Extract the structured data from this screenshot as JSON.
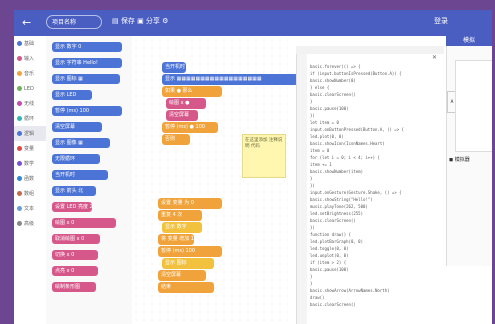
{
  "topbar": {
    "back_label": "←",
    "search_placeholder": "项目名称",
    "tools": "▤ 保存  ▣ 分享  ⚙",
    "user": "登录"
  },
  "right_tab": "模拟",
  "categories": [
    {
      "label": "基础",
      "color": "#4c73d6"
    },
    {
      "label": "输入",
      "color": "#d6578a"
    },
    {
      "label": "音乐",
      "color": "#f0a33a"
    },
    {
      "label": "LED",
      "color": "#6fb15c"
    },
    {
      "label": "无线",
      "color": "#c44ab4"
    },
    {
      "label": "循环",
      "color": "#2fb7b0"
    },
    {
      "label": "逻辑",
      "color": "#4c73d6"
    },
    {
      "label": "变量",
      "color": "#e04848"
    },
    {
      "label": "数学",
      "color": "#7b4fd6"
    },
    {
      "label": "函数",
      "color": "#2f87d6"
    },
    {
      "label": "数组",
      "color": "#c46a4a"
    },
    {
      "label": "文本",
      "color": "#6a9cd6"
    },
    {
      "label": "高级",
      "color": "#888888"
    }
  ],
  "palette_blocks": [
    "显示 数字 0",
    "显示 字符串 Hello!",
    "显示 图标 ▦",
    "显示 LED",
    "暂停 (ms) 100",
    "清空屏幕",
    "显示 图像 ▦",
    "无限循环",
    "当开机时",
    "显示 箭头 北",
    "设置 LED 亮度 255",
    "绘图 x 0",
    "取消绘图 x 0",
    "切换 x 0",
    "点亮 x 0",
    "绘制条形图"
  ],
  "workspace_blocks": {
    "head": "当开机时",
    "b1": "显示 ▦▦▦▦▦▦▦▦▦▦▦▦▦▦▦▦▦▦",
    "b2": "如果 ● 那么",
    "b3": "绘图 x ●",
    "b4": "清空屏幕",
    "b5": "暂停 (ms) ● 100",
    "b6": "否则",
    "g1": "设置 变量 为 0",
    "g2": "重复 4 次",
    "g3": "显示 数字",
    "g4": "将 变量 增加 1",
    "g5": "暂停 (ms) 100",
    "g6": "显示 图标",
    "g7": "清空屏幕",
    "g8": "结束"
  },
  "note_text": "在这里添加 注释说明 代码",
  "code_lines": [
    "basic.forever(() => {",
    "  if (input.buttonIsPressed(Button.A)) {",
    "    basic.showNumber(0)",
    "  } else {",
    "    basic.clearScreen()",
    "  }",
    "  basic.pause(100)",
    "})",
    "let item = 0",
    "input.onButtonPressed(Button.A, () => {",
    "  led.plot(0, 0)",
    "  basic.showIcon(IconNames.Heart)",
    "  item = 0",
    "  for (let i = 0; i < 4; i++) {",
    "    item += 1",
    "    basic.showNumber(item)",
    "  }",
    "})",
    "input.onGesture(Gesture.Shake, () => {",
    "  basic.showString(\"Hello!\")",
    "  music.playTone(262, 500)",
    "  led.setBrightness(255)",
    "  basic.clearScreen()",
    "})",
    "function draw() {",
    "  led.plotBarGraph(0, 0)",
    "  led.toggle(0, 0)",
    "  led.unplot(0, 0)",
    "  if (item > 2) {",
    "    basic.pause(100)",
    "  }",
    "}",
    "basic.showArrow(ArrowNames.North)",
    "draw()",
    "basic.clearScreen()"
  ],
  "device": {
    "label": "◼ 模拟器",
    "side_label": "A"
  }
}
